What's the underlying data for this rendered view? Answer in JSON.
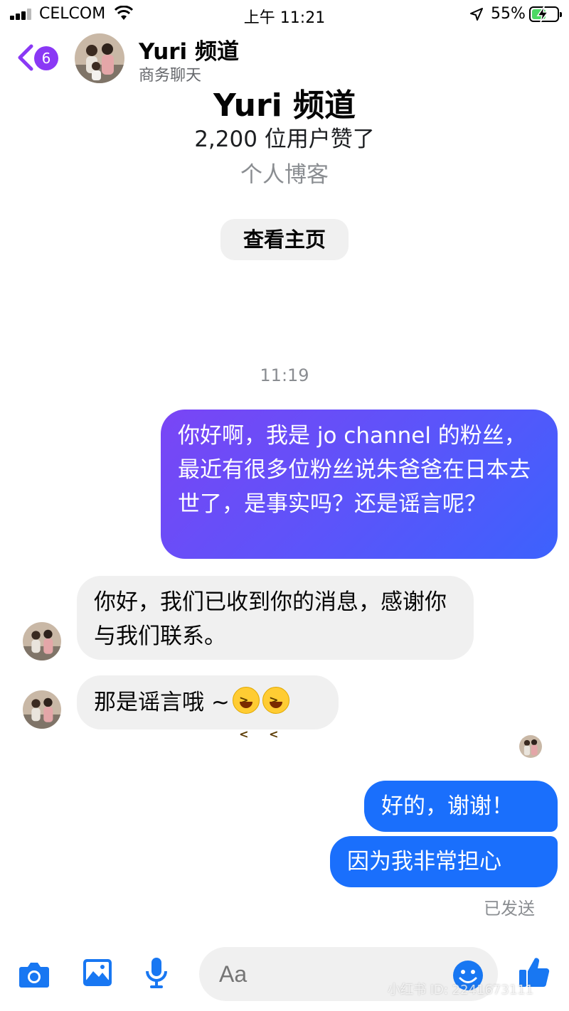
{
  "status_bar": {
    "carrier": "CELCOM",
    "time": "上午 11:21",
    "battery_percent": "55%",
    "battery_level": 0.55
  },
  "header": {
    "back_badge": "6",
    "title": "Yuri 频道",
    "subtitle": "商务聊天"
  },
  "profile": {
    "name": "Yuri 频道",
    "likes": "2,200 位用户赞了",
    "category": "个人博客",
    "view_page_label": "查看主页"
  },
  "conversation": {
    "timestamp": "11:19",
    "messages": [
      {
        "from": "me",
        "text": "你好啊，我是 jo channel 的粉丝，最近有很多位粉丝说朱爸爸在日本去世了，是事实吗？还是谣言呢？"
      },
      {
        "from": "page",
        "text": "你好，我们已收到你的消息，感谢你与我们联系。"
      },
      {
        "from": "page",
        "text": "那是谣言哦 ~",
        "emojis": [
          "grinning-squinting-face",
          "grinning-squinting-face"
        ]
      },
      {
        "from": "me",
        "text": "好的，谢谢！"
      },
      {
        "from": "me",
        "text": "因为我非常担心"
      }
    ],
    "sent_status": "已发送"
  },
  "composer": {
    "placeholder": "Aa"
  },
  "watermark": "小红书 ID: 2241673111",
  "colors": {
    "accent": "#8a38f5",
    "sent_bubble": "#1a6ffc",
    "received_bubble": "#f0f0f0",
    "icon_blue": "#1877f2"
  }
}
